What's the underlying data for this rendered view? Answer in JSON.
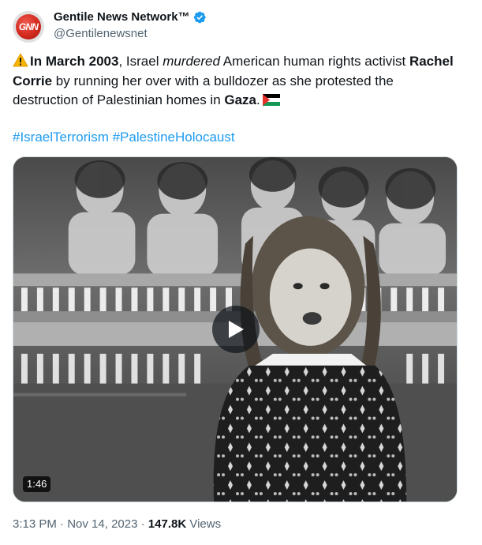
{
  "author": {
    "display_name": "Gentile News Network™",
    "handle": "@Gentilenewsnet",
    "avatar_text": "GNN",
    "verified": true
  },
  "tweet": {
    "text_lead": "In March 2003",
    "text_part1": ", Israel ",
    "text_emph": "murdered",
    "text_part2": " American human rights activist ",
    "text_name": "Rachel Corrie",
    "text_part3": " by running her over with a bulldozer as she protested the destruction of Palestinian homes in ",
    "text_place": "Gaza",
    "text_end": ".",
    "hashtags": [
      "#IsraelTerrorism",
      "#PalestineHolocaust"
    ]
  },
  "media": {
    "type": "video",
    "duration": "1:46"
  },
  "meta": {
    "time": "3:13 PM",
    "separator": "·",
    "date": "Nov 14, 2023",
    "views_count": "147.8K",
    "views_label": "Views"
  },
  "colors": {
    "link": "#1d9bf0",
    "secondary_text": "#536471",
    "verified": "#1d9bf0",
    "avatar_red": "#d32a1f"
  },
  "icons": {
    "warning": "warning-emoji",
    "flag": "palestine-flag-emoji",
    "verified": "verified-badge-icon",
    "play": "play-icon"
  }
}
